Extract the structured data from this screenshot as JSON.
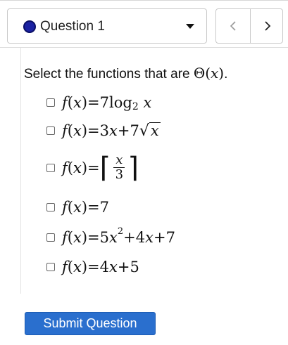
{
  "question_selector": {
    "label": "Question 1",
    "status_color": "#1b22a3"
  },
  "nav": {
    "prev_icon": "chevron-left-icon",
    "next_icon": "chevron-right-icon"
  },
  "prompt": {
    "text": "Select the functions that are ",
    "math": "Θ(𝑥)",
    "end": "."
  },
  "options": [
    {
      "lhs": "f(x) =",
      "expr": "7 log₂ x",
      "checked": false
    },
    {
      "lhs": "f(x) =",
      "expr": "3x + 7√x",
      "checked": false
    },
    {
      "lhs": "f(x) =",
      "expr": "⌈x/3⌉",
      "checked": false
    },
    {
      "lhs": "f(x) =",
      "expr": "7",
      "checked": false
    },
    {
      "lhs": "f(x) =",
      "expr": "5x² + 4x + 7",
      "checked": false
    },
    {
      "lhs": "f(x) =",
      "expr": "4x + 5",
      "checked": false
    }
  ],
  "math_parts": {
    "f": "f",
    "lp": "(",
    "x": "x",
    "rp": ")",
    "eq": " = ",
    "seven": "7",
    "log": " log",
    "two": "2",
    "three": "3",
    "plus": " + ",
    "five": "5",
    "four": "4",
    "sqrt": "√",
    "lceil": "⌈",
    "rceil": "⌉"
  },
  "submit": {
    "label": "Submit Question",
    "color": "#2a6fce"
  }
}
